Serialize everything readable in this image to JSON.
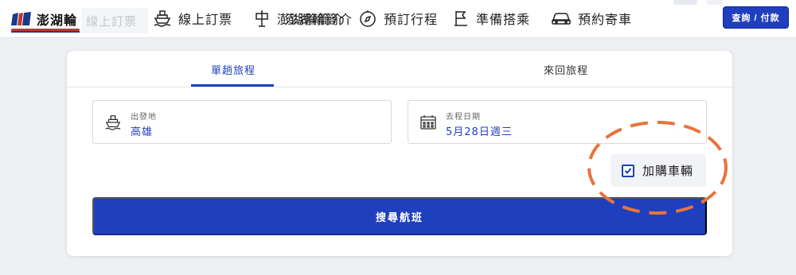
{
  "brand": {
    "name": "澎湖輪"
  },
  "ghost_field": "線上訂票",
  "nav": [
    {
      "label": "線上訂票",
      "icon": "ship-icon"
    },
    {
      "label": "澎湖輪簡介",
      "icon": "signpost-icon"
    },
    {
      "label": "預訂行程",
      "icon": "compass-icon"
    },
    {
      "label": "準備搭乘",
      "icon": "checklist-icon"
    },
    {
      "label": "預約寄車",
      "icon": "car-icon"
    }
  ],
  "header": {
    "pay_button": "查詢 / 付款"
  },
  "tabs": [
    {
      "label": "單趟旅程",
      "active": true
    },
    {
      "label": "來回旅程",
      "active": false
    }
  ],
  "form": {
    "origin": {
      "label": "出發地",
      "value": "高雄",
      "icon": "ship-icon"
    },
    "date": {
      "label": "去程日期",
      "value": "5月28日週三",
      "icon": "calendar-icon"
    },
    "addon": {
      "label": "加購車輛",
      "checked": true
    },
    "search_button": "搜尋航班"
  },
  "colors": {
    "accent": "#1f3fbf",
    "annotation": "#e8743b",
    "background": "#eef0f4"
  }
}
